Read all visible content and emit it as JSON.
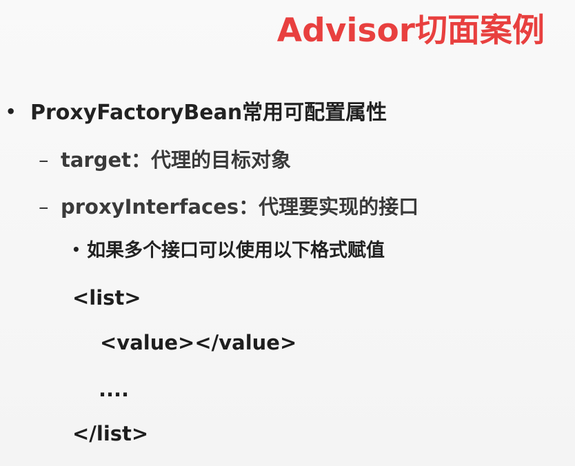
{
  "slide": {
    "title": "Advisor切面案例",
    "title_color": "#e8403f",
    "text_color": "#222222",
    "bullet_l1": "•",
    "bullet_l2": "–",
    "bullet_l3": "•",
    "items": [
      "ProxyFactoryBean常用可配置属性",
      "target：代理的目标对象",
      "proxyInterfaces：代理要实现的接口",
      "如果多个接口可以使用以下格式赋值"
    ],
    "code_lines": [
      "<list>",
      "<value></value>",
      "....",
      "</list>"
    ]
  }
}
